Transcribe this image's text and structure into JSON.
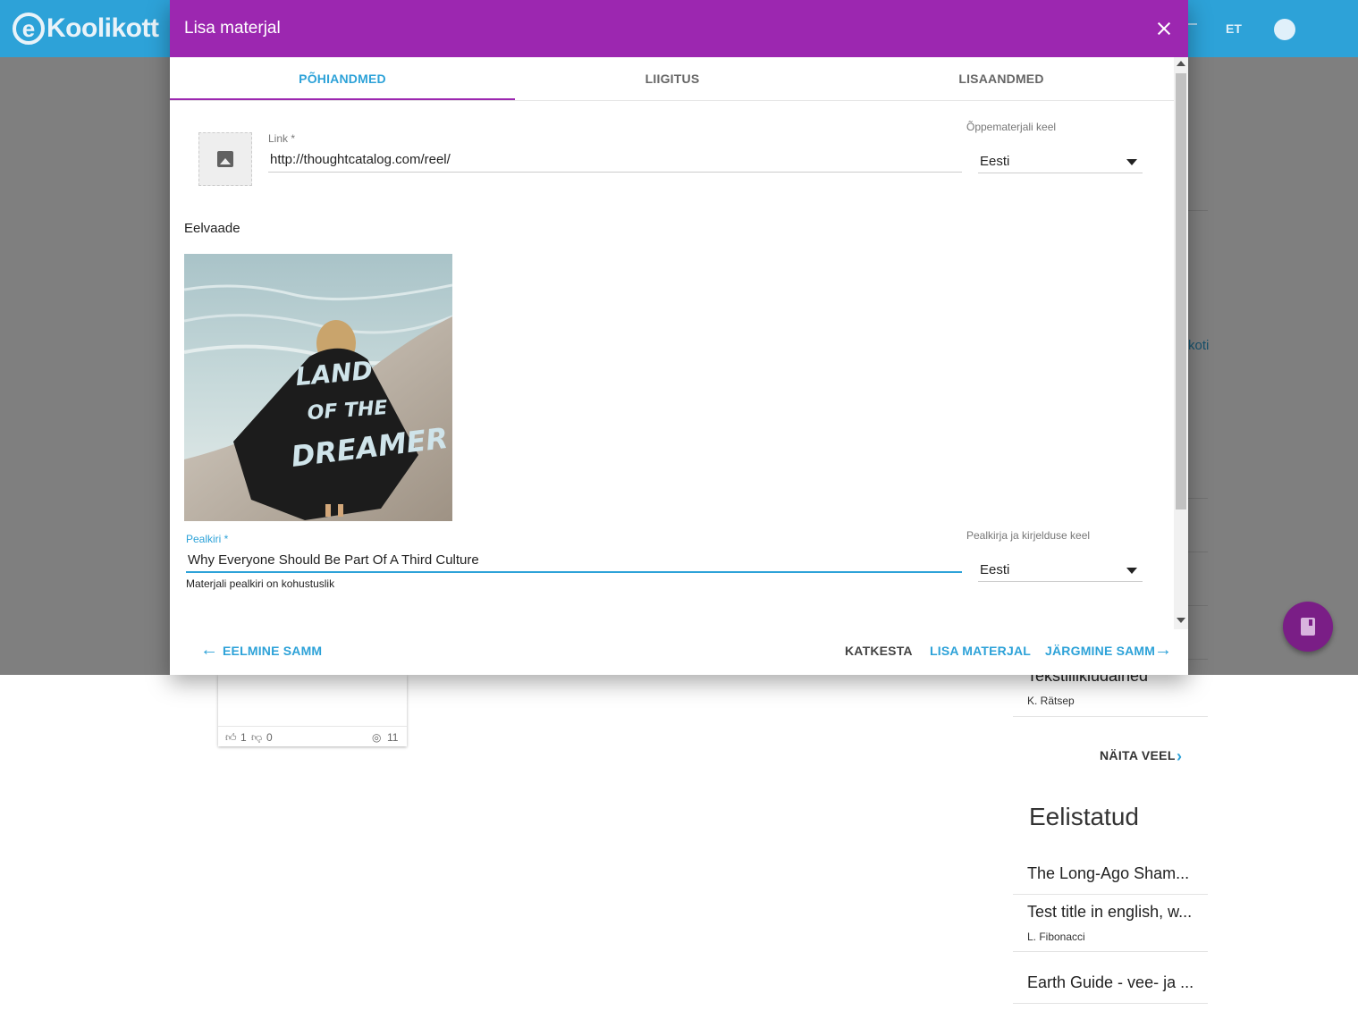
{
  "app": {
    "logo_text": "Koolikott",
    "logo_letter": "e",
    "language": "ET"
  },
  "background": {
    "link_fragment": "koti",
    "card": {
      "likes": "1",
      "dislikes": "0",
      "views": "11"
    },
    "recent_item": {
      "title": "Tekstiilikiudained",
      "author": "K. Rätsep"
    },
    "show_more_label": "NÄITA VEEL",
    "favorites_heading": "Eelistatud",
    "favorites": [
      {
        "title": "The Long-Ago Sham...",
        "author": ""
      },
      {
        "title": "Test title in english, w...",
        "author": "L. Fibonacci"
      },
      {
        "title": "Earth Guide - vee- ja ...",
        "author": ""
      }
    ]
  },
  "dialog": {
    "title": "Lisa materjal",
    "tabs": [
      {
        "label": "PÕHIANDMED",
        "active": true
      },
      {
        "label": "LIIGITUS",
        "active": false
      },
      {
        "label": "LISAANDMED",
        "active": false
      }
    ],
    "link": {
      "label": "Link *",
      "value": "http://thoughtcatalog.com/reel/"
    },
    "material_language": {
      "label": "Õppematerjali keel",
      "value": "Eesti"
    },
    "preview_label": "Eelvaade",
    "preview_image_text": [
      "LAND",
      "OF THE",
      "DREAMER"
    ],
    "title_field": {
      "label": "Pealkiri *",
      "value": "Why Everyone Should Be Part Of A Third Culture",
      "hint": "Materjali pealkiri on kohustuslik"
    },
    "title_language": {
      "label": "Pealkirja ja kirjelduse keel",
      "value": "Eesti"
    },
    "buttons": {
      "previous": "EELMINE SAMM",
      "cancel": "KATKESTA",
      "add": "LISA MATERJAL",
      "next": "JÄRGMINE SAMM"
    }
  },
  "colors": {
    "header_purple": "#9c27b0",
    "topbar_blue": "#2da2d8",
    "accent_blue": "#2da2d8",
    "fab_purple": "#7a1e86"
  }
}
